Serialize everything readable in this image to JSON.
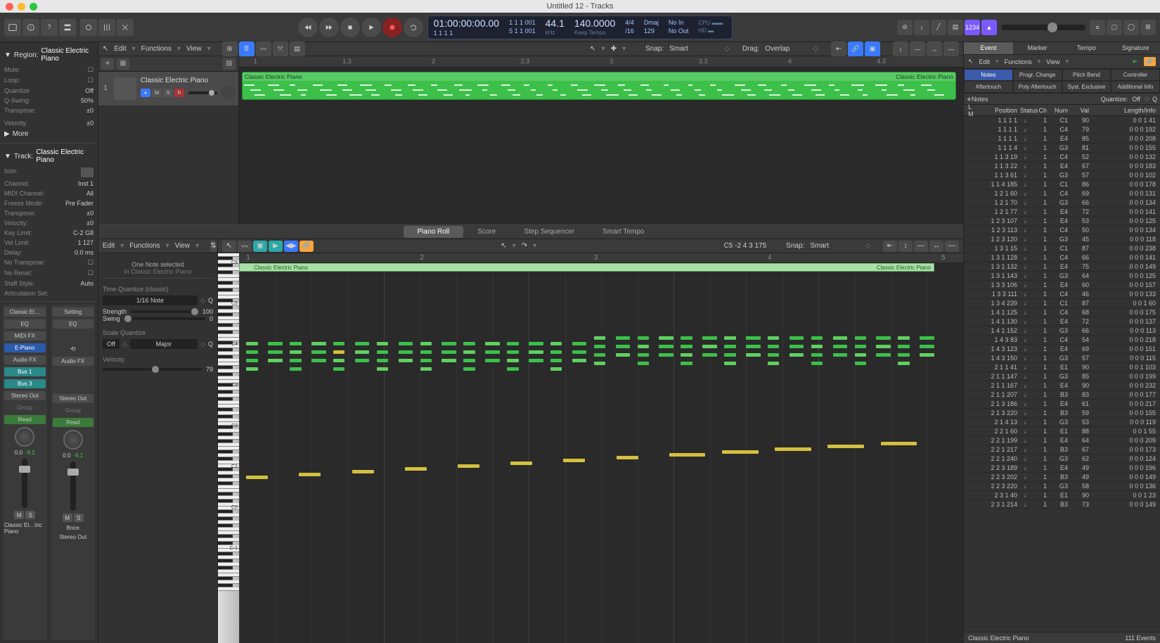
{
  "title": "Untitled 12 - Tracks",
  "lcd": {
    "tc": "01:00:00:00.00",
    "bars1": "1 1 1  001",
    "bars2": "1 1 1  001",
    "bars3": "1  1  1           1",
    "bars4": "5  1  1  001",
    "sr": "44.1",
    "sr_unit": "kHz",
    "tempo": "140.0000",
    "keep": "Keep Tempo",
    "sig": "4/4",
    "div": "/16",
    "key": "Dmaj",
    "beat": "129",
    "noin": "No In",
    "noout": "No Out"
  },
  "master_toggle": "1234",
  "region": {
    "header": "Region:",
    "name": "Classic Electric Piano",
    "mute": "Mute:",
    "loop": "Loop:",
    "quantize_l": "Quantize",
    "quantize_v": "Off",
    "qswing_l": "Q-Swing:",
    "qswing_v": "50%",
    "transpose_l": "Transpose:",
    "transpose_v": "±0",
    "velocity_l": "Velocity:",
    "velocity_v": "±0",
    "more": "More"
  },
  "track": {
    "header": "Track:",
    "name": "Classic Electric Piano",
    "icon_l": "Icon:",
    "channel_l": "Channel:",
    "channel_v": "Inst 1",
    "midich_l": "MIDI Channel:",
    "midich_v": "All",
    "freeze_l": "Freeze Mode:",
    "freeze_v": "Pre Fader",
    "transpose_l": "Transpose:",
    "transpose_v": "±0",
    "velocity_l": "Velocity:",
    "velocity_v": "±0",
    "keylim_l": "Key Limit:",
    "keylim_v": "C-2  G8",
    "vellim_l": "Vel Limit:",
    "vellim_v": "1  127",
    "delay_l": "Delay:",
    "delay_v": "0.0 ms",
    "notrans_l": "No Transpose:",
    "noreset_l": "No Reset:",
    "staff_l": "Staff Style:",
    "staff_v": "Auto",
    "artset_l": "Articulation Set:"
  },
  "strip1": {
    "name": "Classic El…",
    "eq": "EQ",
    "midifx": "MIDI FX",
    "inst": "E-Piano",
    "audiofx": "Audio FX",
    "bus1": "Bus 1",
    "bus2": "Bus 3",
    "out": "Stereo Out",
    "grp": "Group",
    "read": "Read",
    "db1": "0.0",
    "db2": "-9.2",
    "label": "Classic El…tric Piano"
  },
  "strip2": {
    "name": "Setting",
    "eq": "EQ",
    "audiofx": "Audio FX",
    "out": "Stereo Out",
    "grp": "Group",
    "read": "Read",
    "db1": "0.0",
    "db2": "-9.1",
    "bnce": "Bnce",
    "label": "Stereo Out"
  },
  "ms": {
    "m": "M",
    "s": "S"
  },
  "arrange": {
    "menu": {
      "edit": "Edit",
      "functions": "Functions",
      "view": "View"
    },
    "snap_l": "Snap:",
    "snap_v": "Smart",
    "drag_l": "Drag:",
    "drag_v": "Overlap",
    "ruler": [
      "1",
      "1.3",
      "2",
      "2.3",
      "3",
      "3.3",
      "4",
      "4.3"
    ],
    "region_name": "Classic Electric Piano"
  },
  "editor_tabs": [
    "Piano Roll",
    "Score",
    "Step Sequencer",
    "Smart Tempo"
  ],
  "editor": {
    "menu": {
      "edit": "Edit",
      "functions": "Functions",
      "view": "View"
    },
    "info": "C5  -2 4 3 175",
    "snap_l": "Snap:",
    "snap_v": "Smart",
    "sel_line1": "One Note selected",
    "sel_line2": "in Classic Electric Piano",
    "tq_hdr": "Time Quantize (classic)",
    "tq_val": "1/16 Note",
    "strength_l": "Strength",
    "strength_v": "100",
    "swing_l": "Swing",
    "swing_v": "0",
    "sq_hdr": "Scale Quantize",
    "sq_on": "Off",
    "sq_scale": "Major",
    "vel_hdr": "Velocity",
    "vel_v": "79",
    "q": "Q",
    "octaves": [
      "C6",
      "C5",
      "C4",
      "C3",
      "C2",
      "C1",
      "C0",
      "C-1"
    ],
    "pr_ruler": [
      "1",
      "2",
      "3",
      "4",
      "5"
    ],
    "region_name": "Classic Electric Piano"
  },
  "rpanel": {
    "tabs": [
      "Event",
      "Marker",
      "Tempo",
      "Signature"
    ],
    "menu": {
      "edit": "Edit",
      "functions": "Functions",
      "view": "View"
    },
    "filter": [
      "Notes",
      "Progr. Change",
      "Pitch Bend",
      "Controller",
      "Aftertouch",
      "Poly Aftertouch",
      "Syst. Exclusive",
      "Additional Info"
    ],
    "notes_l": "Notes",
    "quant_l": "Quantize:",
    "quant_v": "Off",
    "cols": {
      "lm": "L  M",
      "pos": "Position",
      "status": "Status",
      "ch": "Ch",
      "num": "Num",
      "val": "Val",
      "len": "Length/Info"
    },
    "footer_l": "Classic Electric Piano",
    "footer_r": "111 Events"
  },
  "events": [
    {
      "p": "1 1 1    1",
      "ch": 1,
      "n": "C1",
      "v": 90,
      "l": "0 0 1  41"
    },
    {
      "p": "1 1 1    1",
      "ch": 1,
      "n": "C4",
      "v": 79,
      "l": "0 0 0 192"
    },
    {
      "p": "1 1 1    1",
      "ch": 1,
      "n": "E4",
      "v": 85,
      "l": "0 0 0 208"
    },
    {
      "p": "1 1 1    4",
      "ch": 1,
      "n": "G3",
      "v": 81,
      "l": "0 0 0 155"
    },
    {
      "p": "1 1 3   19",
      "ch": 1,
      "n": "C4",
      "v": 52,
      "l": "0 0 0 132"
    },
    {
      "p": "1 1 3   22",
      "ch": 1,
      "n": "E4",
      "v": 67,
      "l": "0 0 0 183"
    },
    {
      "p": "1 1 3   61",
      "ch": 1,
      "n": "G3",
      "v": 57,
      "l": "0 0 0 102"
    },
    {
      "p": "1 1 4 185",
      "ch": 1,
      "n": "C1",
      "v": 86,
      "l": "0 0 0 178"
    },
    {
      "p": "1 2 1   60",
      "ch": 1,
      "n": "C4",
      "v": 69,
      "l": "0 0 0 131"
    },
    {
      "p": "1 2 1   70",
      "ch": 1,
      "n": "G3",
      "v": 66,
      "l": "0 0 0 134"
    },
    {
      "p": "1 2 1   77",
      "ch": 1,
      "n": "E4",
      "v": 72,
      "l": "0 0 0 141"
    },
    {
      "p": "1 2 3 107",
      "ch": 1,
      "n": "E4",
      "v": 53,
      "l": "0 0 0 125"
    },
    {
      "p": "1 2 3 113",
      "ch": 1,
      "n": "C4",
      "v": 50,
      "l": "0 0 0 134"
    },
    {
      "p": "1 2 3 120",
      "ch": 1,
      "n": "G3",
      "v": 45,
      "l": "0 0 0 118"
    },
    {
      "p": "1 3 1   15",
      "ch": 1,
      "n": "C1",
      "v": 87,
      "l": "0 0 0 238"
    },
    {
      "p": "1 3 1 128",
      "ch": 1,
      "n": "C4",
      "v": 66,
      "l": "0 0 0 141"
    },
    {
      "p": "1 3 1 132",
      "ch": 1,
      "n": "E4",
      "v": 75,
      "l": "0 0 0 149"
    },
    {
      "p": "1 3 1 143",
      "ch": 1,
      "n": "G3",
      "v": 64,
      "l": "0 0 0 125"
    },
    {
      "p": "1 3 3 106",
      "ch": 1,
      "n": "E4",
      "v": 60,
      "l": "0 0 0 157"
    },
    {
      "p": "1 3 3 111",
      "ch": 1,
      "n": "C4",
      "v": 46,
      "l": "0 0 0 133"
    },
    {
      "p": "1 3 4 239",
      "ch": 1,
      "n": "C1",
      "v": 87,
      "l": "0 0 1  60"
    },
    {
      "p": "1 4 1 125",
      "ch": 1,
      "n": "C4",
      "v": 68,
      "l": "0 0 0 175"
    },
    {
      "p": "1 4 1 130",
      "ch": 1,
      "n": "E4",
      "v": 72,
      "l": "0 0 0 137"
    },
    {
      "p": "1 4 1 152",
      "ch": 1,
      "n": "G3",
      "v": 66,
      "l": "0 0 0 113"
    },
    {
      "p": "1 4 3   83",
      "ch": 1,
      "n": "C4",
      "v": 54,
      "l": "0 0 0 218"
    },
    {
      "p": "1 4 3 123",
      "ch": 1,
      "n": "E4",
      "v": 69,
      "l": "0 0 0 151"
    },
    {
      "p": "1 4 3 150",
      "ch": 1,
      "n": "G3",
      "v": 57,
      "l": "0 0 0 115"
    },
    {
      "p": "2 1 1   41",
      "ch": 1,
      "n": "E1",
      "v": 90,
      "l": "0 0 1 103"
    },
    {
      "p": "2 1 1 147",
      "ch": 1,
      "n": "G3",
      "v": 85,
      "l": "0 0 0 199"
    },
    {
      "p": "2 1 1 167",
      "ch": 1,
      "n": "E4",
      "v": 90,
      "l": "0 0 0 232"
    },
    {
      "p": "2 1 1 207",
      "ch": 1,
      "n": "B3",
      "v": 83,
      "l": "0 0 0 177"
    },
    {
      "p": "2 1 3 186",
      "ch": 1,
      "n": "E4",
      "v": 61,
      "l": "0 0 0 217"
    },
    {
      "p": "2 1 3 220",
      "ch": 1,
      "n": "B3",
      "v": 59,
      "l": "0 0 0 155"
    },
    {
      "p": "2 1 4   13",
      "ch": 1,
      "n": "G3",
      "v": 53,
      "l": "0 0 0 119"
    },
    {
      "p": "2 2 1   60",
      "ch": 1,
      "n": "E1",
      "v": 88,
      "l": "0 0 1  55"
    },
    {
      "p": "2 2 1 199",
      "ch": 1,
      "n": "E4",
      "v": 64,
      "l": "0 0 0 209"
    },
    {
      "p": "2 2 1 217",
      "ch": 1,
      "n": "B3",
      "v": 67,
      "l": "0 0 0 173"
    },
    {
      "p": "2 2 1 240",
      "ch": 1,
      "n": "G3",
      "v": 62,
      "l": "0 0 0 124"
    },
    {
      "p": "2 2 3 189",
      "ch": 1,
      "n": "E4",
      "v": 49,
      "l": "0 0 0 196"
    },
    {
      "p": "2 2 3 202",
      "ch": 1,
      "n": "B3",
      "v": 49,
      "l": "0 0 0 149"
    },
    {
      "p": "2 2 3 220",
      "ch": 1,
      "n": "G3",
      "v": 58,
      "l": "0 0 0 136"
    },
    {
      "p": "2 3 1   40",
      "ch": 1,
      "n": "E1",
      "v": 90,
      "l": "0 0 1  23"
    },
    {
      "p": "2 3 1 214",
      "ch": 1,
      "n": "B3",
      "v": 73,
      "l": "0 0 0 149"
    }
  ],
  "status_sym": "♩"
}
